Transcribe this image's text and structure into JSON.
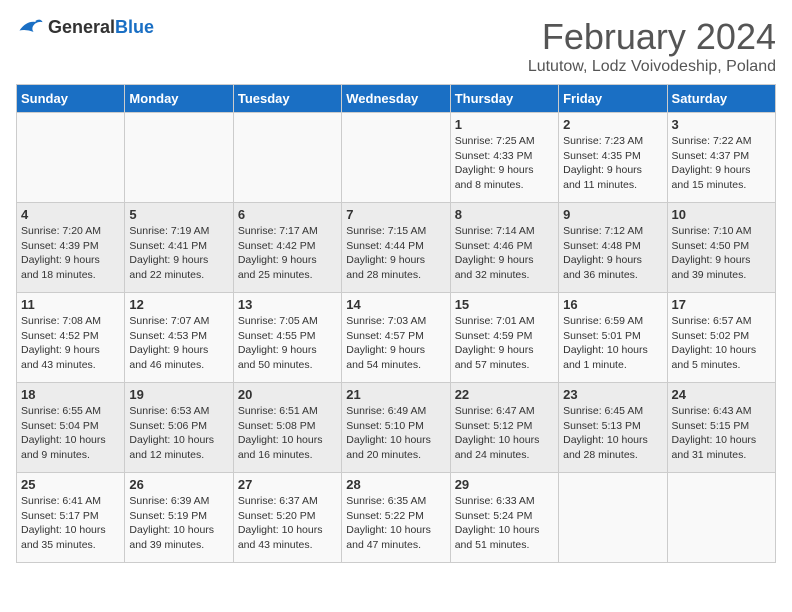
{
  "header": {
    "logo_general": "General",
    "logo_blue": "Blue",
    "month_title": "February 2024",
    "location": "Lututow, Lodz Voivodeship, Poland"
  },
  "days_of_week": [
    "Sunday",
    "Monday",
    "Tuesday",
    "Wednesday",
    "Thursday",
    "Friday",
    "Saturday"
  ],
  "weeks": [
    [
      {
        "day": "",
        "info": ""
      },
      {
        "day": "",
        "info": ""
      },
      {
        "day": "",
        "info": ""
      },
      {
        "day": "",
        "info": ""
      },
      {
        "day": "1",
        "info": "Sunrise: 7:25 AM\nSunset: 4:33 PM\nDaylight: 9 hours\nand 8 minutes."
      },
      {
        "day": "2",
        "info": "Sunrise: 7:23 AM\nSunset: 4:35 PM\nDaylight: 9 hours\nand 11 minutes."
      },
      {
        "day": "3",
        "info": "Sunrise: 7:22 AM\nSunset: 4:37 PM\nDaylight: 9 hours\nand 15 minutes."
      }
    ],
    [
      {
        "day": "4",
        "info": "Sunrise: 7:20 AM\nSunset: 4:39 PM\nDaylight: 9 hours\nand 18 minutes."
      },
      {
        "day": "5",
        "info": "Sunrise: 7:19 AM\nSunset: 4:41 PM\nDaylight: 9 hours\nand 22 minutes."
      },
      {
        "day": "6",
        "info": "Sunrise: 7:17 AM\nSunset: 4:42 PM\nDaylight: 9 hours\nand 25 minutes."
      },
      {
        "day": "7",
        "info": "Sunrise: 7:15 AM\nSunset: 4:44 PM\nDaylight: 9 hours\nand 28 minutes."
      },
      {
        "day": "8",
        "info": "Sunrise: 7:14 AM\nSunset: 4:46 PM\nDaylight: 9 hours\nand 32 minutes."
      },
      {
        "day": "9",
        "info": "Sunrise: 7:12 AM\nSunset: 4:48 PM\nDaylight: 9 hours\nand 36 minutes."
      },
      {
        "day": "10",
        "info": "Sunrise: 7:10 AM\nSunset: 4:50 PM\nDaylight: 9 hours\nand 39 minutes."
      }
    ],
    [
      {
        "day": "11",
        "info": "Sunrise: 7:08 AM\nSunset: 4:52 PM\nDaylight: 9 hours\nand 43 minutes."
      },
      {
        "day": "12",
        "info": "Sunrise: 7:07 AM\nSunset: 4:53 PM\nDaylight: 9 hours\nand 46 minutes."
      },
      {
        "day": "13",
        "info": "Sunrise: 7:05 AM\nSunset: 4:55 PM\nDaylight: 9 hours\nand 50 minutes."
      },
      {
        "day": "14",
        "info": "Sunrise: 7:03 AM\nSunset: 4:57 PM\nDaylight: 9 hours\nand 54 minutes."
      },
      {
        "day": "15",
        "info": "Sunrise: 7:01 AM\nSunset: 4:59 PM\nDaylight: 9 hours\nand 57 minutes."
      },
      {
        "day": "16",
        "info": "Sunrise: 6:59 AM\nSunset: 5:01 PM\nDaylight: 10 hours\nand 1 minute."
      },
      {
        "day": "17",
        "info": "Sunrise: 6:57 AM\nSunset: 5:02 PM\nDaylight: 10 hours\nand 5 minutes."
      }
    ],
    [
      {
        "day": "18",
        "info": "Sunrise: 6:55 AM\nSunset: 5:04 PM\nDaylight: 10 hours\nand 9 minutes."
      },
      {
        "day": "19",
        "info": "Sunrise: 6:53 AM\nSunset: 5:06 PM\nDaylight: 10 hours\nand 12 minutes."
      },
      {
        "day": "20",
        "info": "Sunrise: 6:51 AM\nSunset: 5:08 PM\nDaylight: 10 hours\nand 16 minutes."
      },
      {
        "day": "21",
        "info": "Sunrise: 6:49 AM\nSunset: 5:10 PM\nDaylight: 10 hours\nand 20 minutes."
      },
      {
        "day": "22",
        "info": "Sunrise: 6:47 AM\nSunset: 5:12 PM\nDaylight: 10 hours\nand 24 minutes."
      },
      {
        "day": "23",
        "info": "Sunrise: 6:45 AM\nSunset: 5:13 PM\nDaylight: 10 hours\nand 28 minutes."
      },
      {
        "day": "24",
        "info": "Sunrise: 6:43 AM\nSunset: 5:15 PM\nDaylight: 10 hours\nand 31 minutes."
      }
    ],
    [
      {
        "day": "25",
        "info": "Sunrise: 6:41 AM\nSunset: 5:17 PM\nDaylight: 10 hours\nand 35 minutes."
      },
      {
        "day": "26",
        "info": "Sunrise: 6:39 AM\nSunset: 5:19 PM\nDaylight: 10 hours\nand 39 minutes."
      },
      {
        "day": "27",
        "info": "Sunrise: 6:37 AM\nSunset: 5:20 PM\nDaylight: 10 hours\nand 43 minutes."
      },
      {
        "day": "28",
        "info": "Sunrise: 6:35 AM\nSunset: 5:22 PM\nDaylight: 10 hours\nand 47 minutes."
      },
      {
        "day": "29",
        "info": "Sunrise: 6:33 AM\nSunset: 5:24 PM\nDaylight: 10 hours\nand 51 minutes."
      },
      {
        "day": "",
        "info": ""
      },
      {
        "day": "",
        "info": ""
      }
    ]
  ]
}
